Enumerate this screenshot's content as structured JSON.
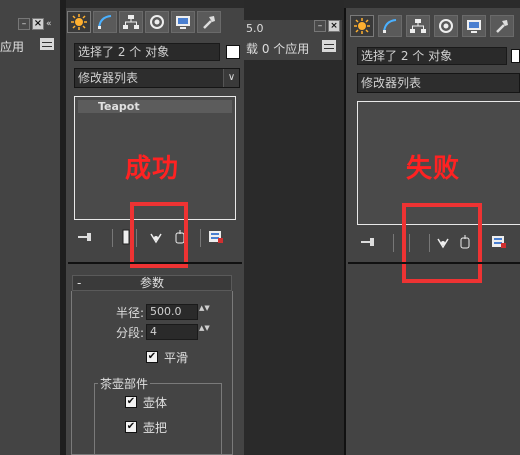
{
  "left_panel": {
    "apply_text": "应用",
    "minimize_label": "–",
    "close_label": "×"
  },
  "mid_strip": {
    "version_text": "5.0",
    "minimize_label": "–",
    "close_label": "×",
    "status_text": "载 0 个应用"
  },
  "panel_success": {
    "selection_text": "选择了 2 个 对象",
    "modifier_list": "修改器列表",
    "stack_item": "Teapot",
    "overlay_label": "成功",
    "rollout": {
      "title": "参数",
      "collapse": "-",
      "radius_label": "半径:",
      "radius_value": "500.0",
      "segments_label": "分段:",
      "segments_value": "4",
      "smooth_label": "平滑",
      "smooth_checked": true,
      "parts_title": "茶壶部件",
      "body_label": "壶体",
      "body_checked": true,
      "handle_label": "壶把",
      "handle_checked": true
    }
  },
  "panel_fail": {
    "selection_text": "选择了 2 个 对象",
    "modifier_list": "修改器列表",
    "overlay_label": "失败"
  },
  "icons": {
    "tabs": [
      "create-icon",
      "modify-icon",
      "hierarchy-icon",
      "motion-icon",
      "display-icon",
      "utilities-icon"
    ],
    "toolbar": [
      "pin-stack-icon",
      "show-end-result-icon",
      "make-unique-icon",
      "remove-modifier-icon",
      "configure-sets-icon"
    ]
  },
  "colors": {
    "highlight_red": "#ee3333",
    "label_red": "#ff2222",
    "panel_gray": "#444444"
  },
  "check_mark": "✔",
  "dropdown_arrow": "∨",
  "spin_arrows": "▲▼"
}
